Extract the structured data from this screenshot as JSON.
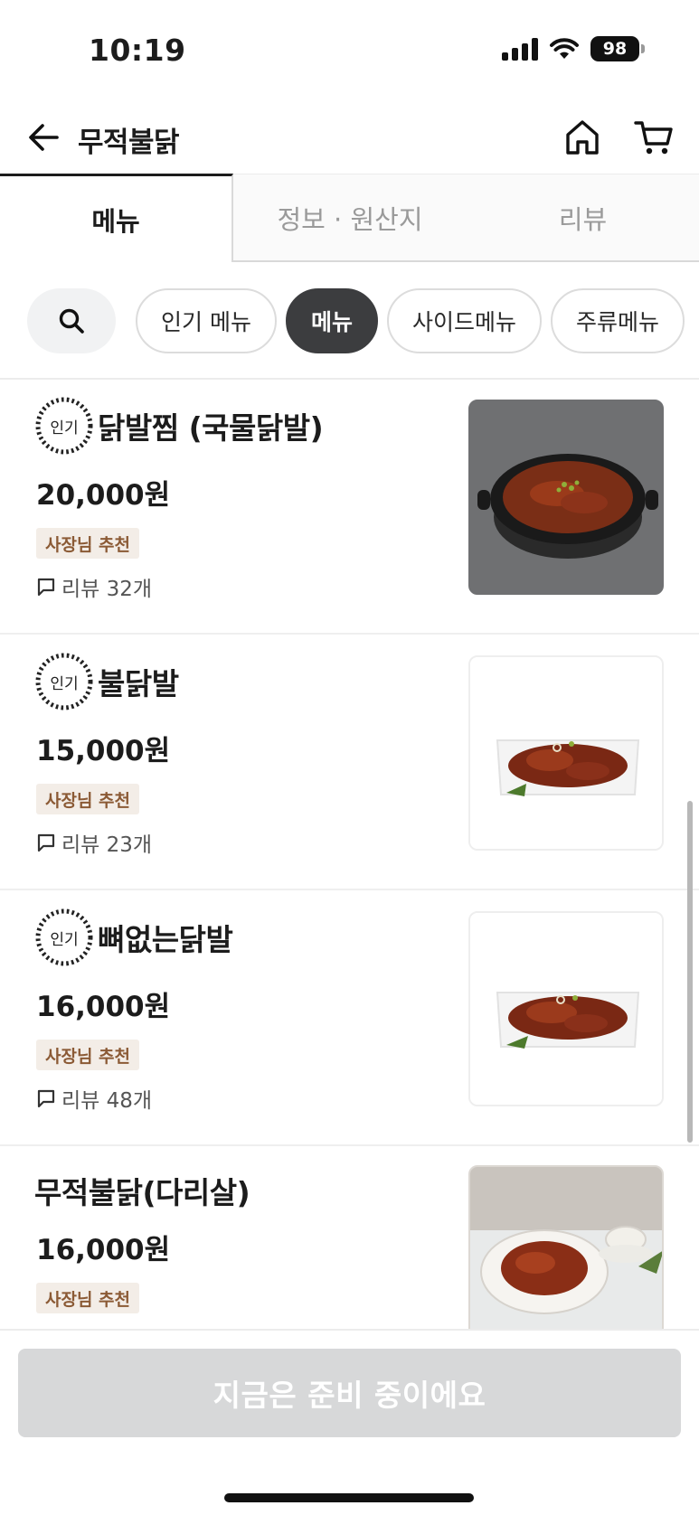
{
  "status_bar": {
    "time": "10:19",
    "battery": "98"
  },
  "header": {
    "title": "무적불닭"
  },
  "tabs": [
    {
      "label": "메뉴"
    },
    {
      "label": "정보 · 원산지"
    },
    {
      "label": "리뷰"
    }
  ],
  "categories": [
    {
      "label": "인기 메뉴"
    },
    {
      "label": "메뉴"
    },
    {
      "label": "사이드메뉴"
    },
    {
      "label": "주류메뉴"
    }
  ],
  "active_category": "메뉴",
  "menu_items": [
    {
      "badge": "인기",
      "name": "닭발찜 (국물닭발)",
      "price": "20,000원",
      "tag": "사장님 추천",
      "review": "리뷰 32개"
    },
    {
      "badge": "인기",
      "name": "불닭발",
      "price": "15,000원",
      "tag": "사장님 추천",
      "review": "리뷰 23개"
    },
    {
      "badge": "인기",
      "name": "뼈없는닭발",
      "price": "16,000원",
      "tag": "사장님 추천",
      "review": "리뷰 48개"
    },
    {
      "name": "무적불닭(다리살)",
      "price": "16,000원",
      "tag": "사장님 추천"
    }
  ],
  "bottom": {
    "order_button": "지금은 준비 중이에요"
  },
  "colors": {
    "active_chip": "#3c3d3f",
    "tag_bg": "#f3ede7",
    "tag_text": "#8b5a35",
    "disabled_button": "#d7d8d9"
  }
}
